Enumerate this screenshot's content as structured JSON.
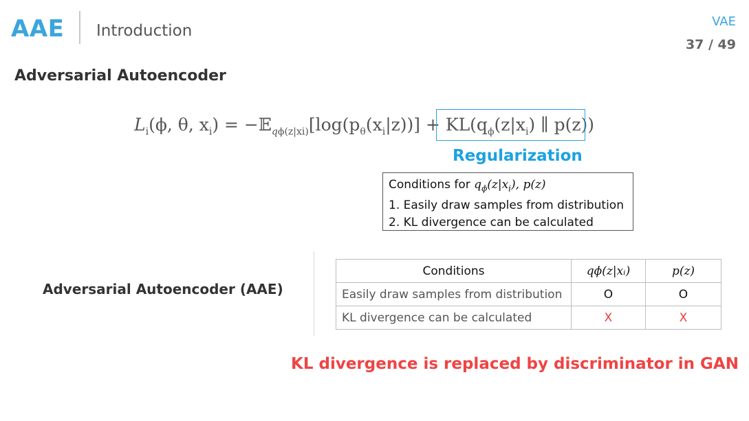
{
  "header": {
    "logo": "AAE",
    "section": "Introduction",
    "tag": "VAE",
    "page": "37 / 49"
  },
  "slide": {
    "heading": "Adversarial Autoencoder",
    "formula": {
      "lhs": "L",
      "lhs_sub": "i",
      "lhs_args": "(ϕ, θ, x",
      "lhs_args_sub": "i",
      "equals": ") = −𝔼",
      "expect_sub": "q",
      "expect_sub2": "ϕ",
      "expect_sub3": "(z|x",
      "expect_sub4": "i",
      "expect_sub5": ")",
      "log_part": "[log(p",
      "log_sub": "θ",
      "log_args": "(x",
      "log_args_sub": "i",
      "log_end": "|z))]",
      "plus": " + ",
      "kl_part": "KL(q",
      "kl_sub": "ϕ",
      "kl_args": "(z|x",
      "kl_args_sub": "i",
      "kl_end": ") ∥ p(z))"
    },
    "regularization_label": "Regularization",
    "conditions_box": {
      "title_prefix": "Conditions for ",
      "title_math": "q",
      "title_math_sub": "ϕ",
      "title_math_rest": "(z|x",
      "title_math_sub2": "i",
      "title_math_end": "), p(z)",
      "items": [
        "1.   Easily draw samples from distribution",
        "2.   KL divergence can be calculated"
      ]
    },
    "aae_label": "Adversarial Autoencoder (AAE)",
    "table": {
      "headers": [
        "Conditions",
        "qϕ(z|xᵢ)",
        "p(z)"
      ],
      "rows": [
        {
          "condition": "Easily draw samples from distribution",
          "q": "O",
          "p": "O"
        },
        {
          "condition": "KL divergence can be calculated",
          "q": "X",
          "p": "X"
        }
      ]
    },
    "conclusion": "KL divergence is replaced by discriminator in GAN"
  },
  "colors": {
    "accent": "#3aa6dc",
    "highlight": "#ef4444"
  }
}
